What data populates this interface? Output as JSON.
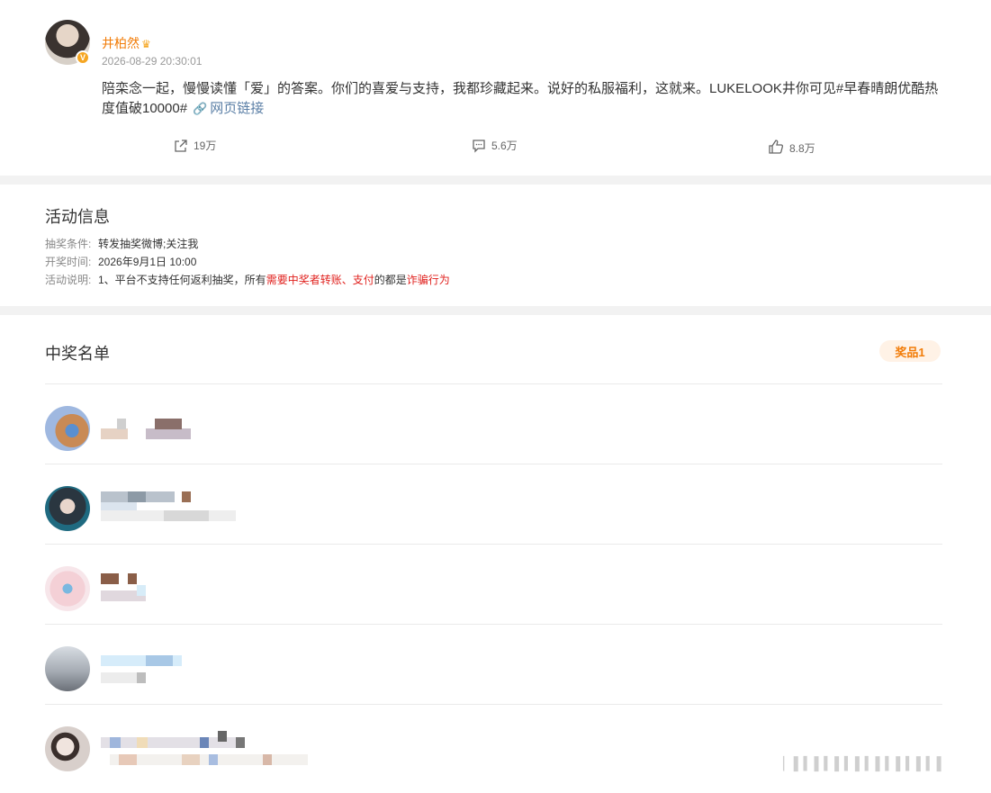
{
  "post": {
    "author": "井柏然",
    "crown_icon": "crown-icon",
    "verified_icon": "verified-badge-icon",
    "time": "2026-08-29 20:30:01",
    "content": "陪栾念一起，慢慢读懂「爱」的答案。你们的喜爱与支持，我都珍藏起来。说好的私服福利，这就来。LUKELOOK井你可见#早春晴朗优酷热度值破10000#",
    "link_label": "网页链接",
    "link_icon": "link-icon",
    "actions": {
      "repost": {
        "icon": "repost-icon",
        "count": "19万"
      },
      "comment": {
        "icon": "comment-icon",
        "count": "5.6万"
      },
      "like": {
        "icon": "like-icon",
        "count": "8.8万"
      }
    }
  },
  "activity": {
    "title": "活动信息",
    "rows": [
      {
        "key": "抽奖条件:",
        "value": "转发抽奖微博;关注我"
      },
      {
        "key": "开奖时间:",
        "value": "2026年9月1日 10:00"
      },
      {
        "key": "活动说明:",
        "value_parts": [
          "1、平台不支持任何返利抽奖，所有",
          "需要中奖者转账、支付",
          "的都是",
          "诈骗行为"
        ]
      }
    ]
  },
  "winners": {
    "title": "中奖名单",
    "prize_label": "奖品1",
    "items": [
      {
        "name": "[pixelated]",
        "detail": "[pixelated]"
      },
      {
        "name": "[pixelated]",
        "detail": "[pixelated]"
      },
      {
        "name": "[pixelated]",
        "detail": "[pixelated]"
      },
      {
        "name": "[pixelated]",
        "detail": "[pixelated]"
      },
      {
        "name": "[pixelated]",
        "detail": "[pixelated]"
      }
    ]
  },
  "colors": {
    "author": "#f27c08",
    "link": "#5b7fa6",
    "warning": "#e0211e",
    "prize_badge_bg": "#fff2e6"
  }
}
